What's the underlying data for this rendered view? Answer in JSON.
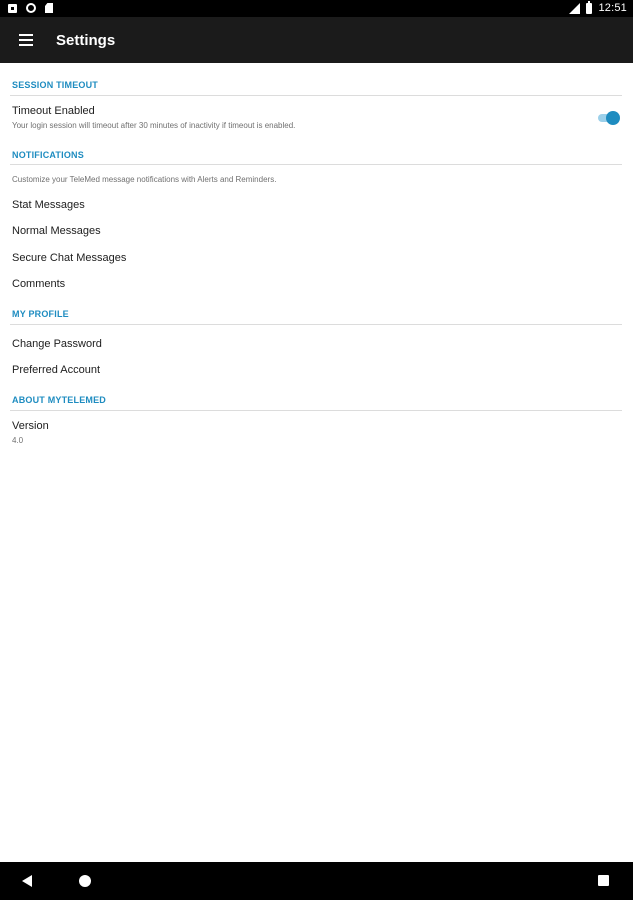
{
  "status_bar": {
    "time": "12:51",
    "icons": [
      "notification-square-icon",
      "sync-circle-icon",
      "sd-card-icon",
      "signal-icon",
      "battery-icon"
    ]
  },
  "app_bar": {
    "title": "Settings",
    "menu_icon": "hamburger-menu-icon"
  },
  "sections": {
    "session_timeout": {
      "header": "SESSION TIMEOUT",
      "timeout": {
        "title": "Timeout Enabled",
        "summary": "Your login session will timeout after 30 minutes of inactivity if timeout is enabled.",
        "enabled": true
      }
    },
    "notifications": {
      "header": "NOTIFICATIONS",
      "description": "Customize your TeleMed message notifications with Alerts and Reminders.",
      "items": [
        "Stat Messages",
        "Normal Messages",
        "Secure Chat Messages",
        "Comments"
      ]
    },
    "my_profile": {
      "header": "MY PROFILE",
      "items": [
        "Change Password",
        "Preferred Account"
      ]
    },
    "about": {
      "header": "ABOUT MYTELEMED",
      "version_title": "Version",
      "version_value": "4.0"
    }
  },
  "colors": {
    "accent": "#1e8cc0",
    "toggle_track": "#9cd0ea",
    "app_bar": "#1b1b1b",
    "divider": "#dcdcdc"
  },
  "nav_bar": {
    "icons": [
      "back-icon",
      "home-icon",
      "recents-icon"
    ]
  }
}
